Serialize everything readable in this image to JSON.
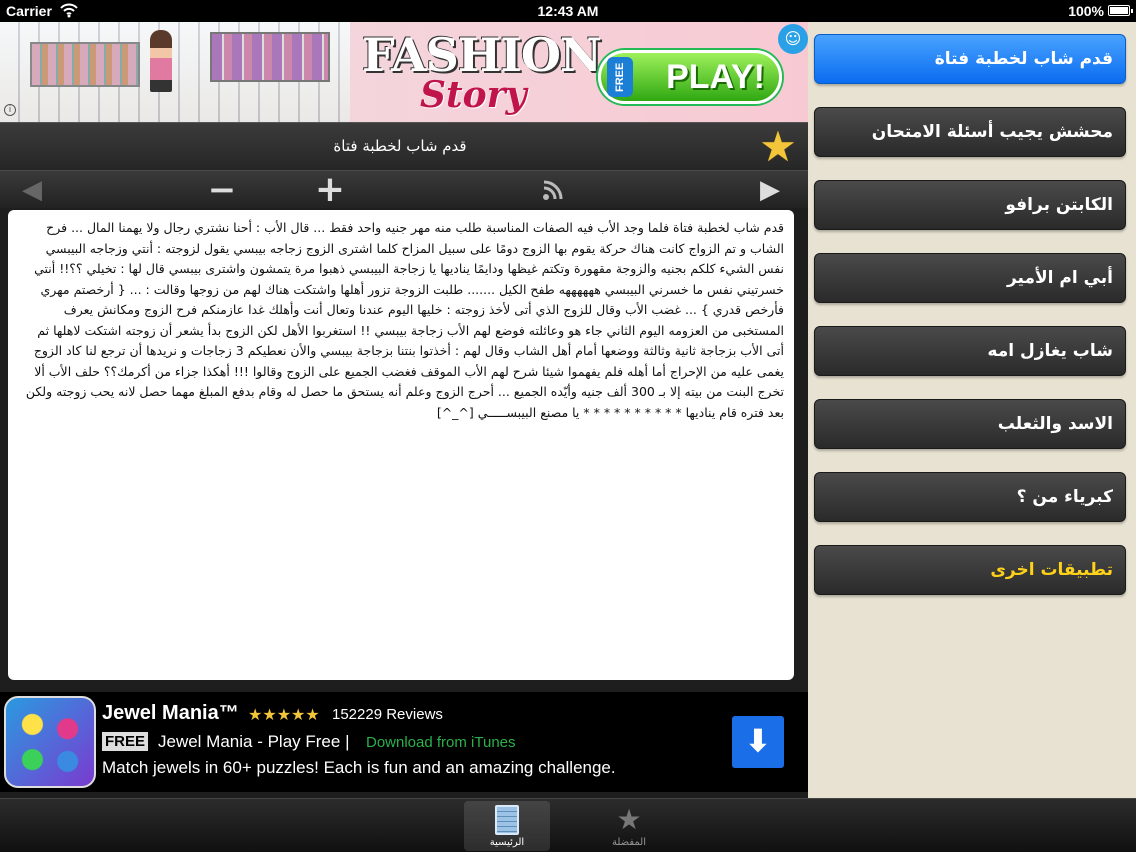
{
  "status_bar": {
    "carrier": "Carrier",
    "time": "12:43 AM",
    "battery": "100%"
  },
  "top_ad": {
    "title": "FASHION",
    "subtitle": "Story",
    "free_label": "FREE",
    "play_label": "PLAY!",
    "info_glyph": "i"
  },
  "article": {
    "title": "قدم شاب لخطبة فتاة",
    "body": "قدم شاب لخطبة فتاة فلما وجد الأب فيه الصفات المناسبة طلب منه مهر جنيه واحد فقط ... قال الأب : أحنا نشتري رجال ولا يهمنا المال ... فرح الشاب و تم الزواج كانت هناك حركة يقوم بها الزوج دومًا على سبيل المزاح كلما اشترى الزوج زجاجه بيبسي يقول لزوجته : أنتي وزجاجه البيبسي نفس الشيء كلكم بجنيه والزوجة مقهورة وتكتم غيظها ودايمًا يناديها يا زجاجة البيبسي ذهبوا مرة يتمشون واشترى بيبسي قال لها : تخيلي ؟؟!! أنتي خسرتيني نفس ما خسرني البيبسي ههههههه طفح الكيل ....... طلبت الزوجة تزور أهلها واشتكت هناك لهم من زوجها وقالت : ... { أرخصتم مهري فأرخص قدري } ... غضب الأب وقال للزوج الذي أتى لأخذ زوجته : خليها اليوم عندنا وتعال أنت وأهلك غدا عازمنكم فرح الزوج ومكانش يعرف المستخبى من العزومه اليوم الثاني جاء هو وعائلته فوضع لهم الأب زجاجة بيبسي !! استغربوا الأهل لكن الزوج بدأ يشعر أن زوجته اشتكت لاهلها ثم أتى الأب بزجاجة ثانية وثالثة ووضعها أمام أهل الشاب وقال لهم : أخذتوا بنتنا بزجاجة بيبسي والأن نعطيكم 3 زجاجات و نريدها أن ترجع لنا كاد الزوج يغمى عليه من الإحراج أما أهله فلم يفهموا شيئا شرح لهم الأب الموقف فغضب الجميع على الزوج وقالوا !!! أهكذا جزاء من أكرمك؟؟ حلف الأب ألا تخرج البنت من بيته إلا بـ 300 ألف جنيه وأيّده الجميع ... أحرج الزوج وعلم أنه يستحق ما حصل له وقام بدفع المبلغ مهما حصل لانه يحب زوجته ولكن بعد فتره قام يناديها * * * * * * * * * * يا مصنع البيبســـــي [^_^]"
  },
  "bottom_ad": {
    "title": "Jewel Mania™",
    "stars": "★★★★★",
    "reviews": "152229 Reviews",
    "free_label": "FREE",
    "name": "Jewel Mania - Play Free |",
    "download_label": "Download from iTunes",
    "description": "Match jewels in 60+ puzzles! Each is fun and an amazing challenge."
  },
  "sidebar": {
    "items": [
      {
        "label": "قدم شاب لخطبة فتاة",
        "active": true
      },
      {
        "label": "محشش يجيب أسئلة الامتحان"
      },
      {
        "label": "الكابتن برافو"
      },
      {
        "label": "أبي ام الأمير"
      },
      {
        "label": "شاب يغازل امه"
      },
      {
        "label": "الاسد والثعلب"
      },
      {
        "label": "كبرياء من ؟"
      },
      {
        "label": "تطبيقات اخرى",
        "highlight": true
      }
    ]
  },
  "tab_bar": {
    "home_label": "الرئيسية",
    "favorites_label": "المفضلة"
  },
  "colors": {
    "active_item": "#0a6cf0",
    "highlight_text": "#ffd21a",
    "sidebar_bg": "#e7e2d1",
    "star": "#f2c53a"
  },
  "icons": [
    "wifi-icon",
    "battery-icon",
    "star-icon",
    "previous-icon",
    "zoom-out-icon",
    "zoom-in-icon",
    "rss-icon",
    "next-icon",
    "download-icon",
    "notepad-icon"
  ]
}
